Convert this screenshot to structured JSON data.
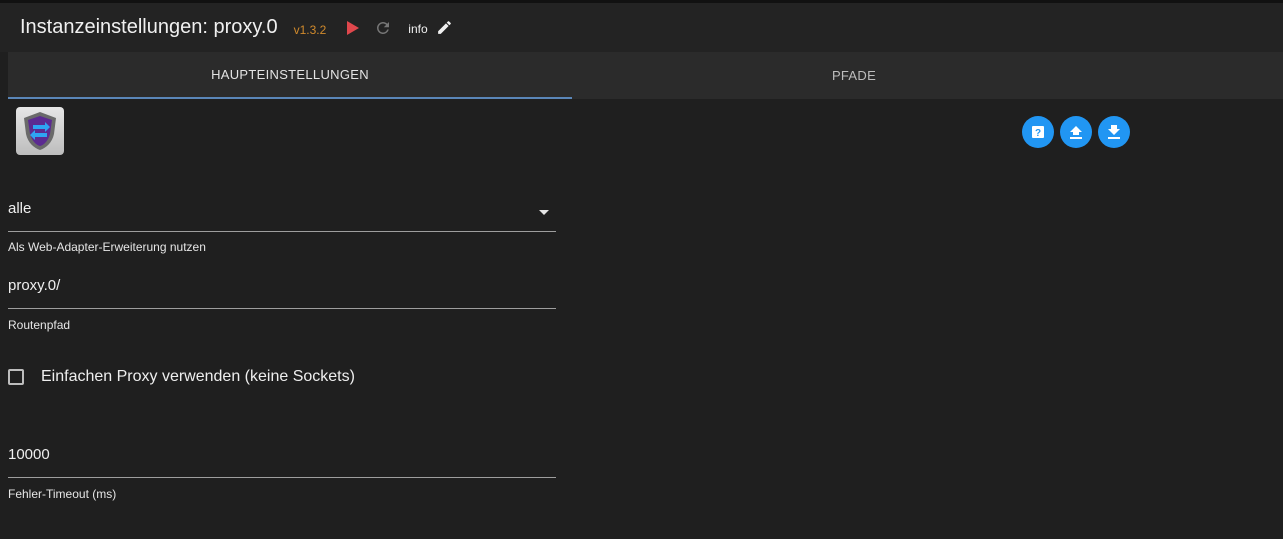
{
  "header": {
    "title": "Instanzeinstellungen: proxy.0",
    "version": "v1.3.2",
    "info_label": "info",
    "play_icon": "play-icon",
    "reload_icon": "reload-icon",
    "edit_icon": "pencil-icon"
  },
  "tabs": [
    {
      "label": "HAUPTEINSTELLUNGEN",
      "active": true
    },
    {
      "label": "PFADE",
      "active": false
    }
  ],
  "actions": [
    {
      "icon": "help-icon"
    },
    {
      "icon": "upload-icon"
    },
    {
      "icon": "download-icon"
    }
  ],
  "form": {
    "web_adapter": {
      "value": "alle",
      "helper": "Als Web-Adapter-Erweiterung nutzen"
    },
    "route_path": {
      "value": "proxy.0/",
      "helper": "Routenpfad"
    },
    "simple_proxy": {
      "label": "Einfachen Proxy verwenden (keine Sockets)",
      "checked": false
    },
    "error_timeout": {
      "value": "10000",
      "helper": "Fehler-Timeout (ms)"
    }
  },
  "colors": {
    "accent": "#2196f3",
    "version": "#d08a2c",
    "play": "#e0474c",
    "tab_indicator": "#5a86b8"
  }
}
